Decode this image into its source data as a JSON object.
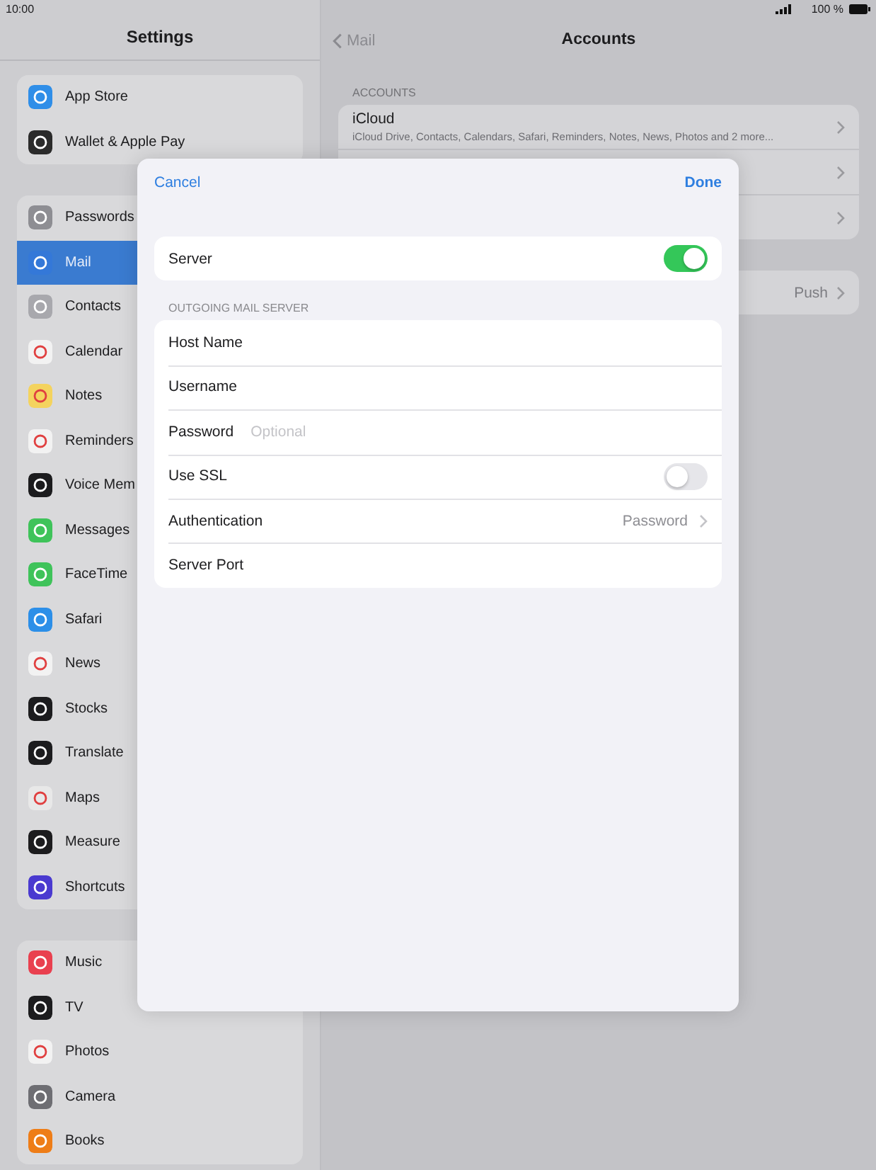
{
  "status_bar": {
    "time": "10:00",
    "battery": "100 %"
  },
  "sidebar": {
    "title": "Settings",
    "groups": [
      {
        "items": [
          {
            "label": "App Store",
            "selected": false
          },
          {
            "label": "Wallet & Apple Pay",
            "selected": false
          }
        ]
      },
      {
        "items": [
          {
            "label": "Passwords",
            "selected": false
          },
          {
            "label": "Mail",
            "selected": true
          },
          {
            "label": "Contacts",
            "selected": false
          },
          {
            "label": "Calendar",
            "selected": false
          },
          {
            "label": "Notes",
            "selected": false
          },
          {
            "label": "Reminders",
            "selected": false
          },
          {
            "label": "Voice Mem",
            "selected": false
          },
          {
            "label": "Messages",
            "selected": false
          },
          {
            "label": "FaceTime",
            "selected": false
          },
          {
            "label": "Safari",
            "selected": false
          },
          {
            "label": "News",
            "selected": false
          },
          {
            "label": "Stocks",
            "selected": false
          },
          {
            "label": "Translate",
            "selected": false
          },
          {
            "label": "Maps",
            "selected": false
          },
          {
            "label": "Measure",
            "selected": false
          },
          {
            "label": "Shortcuts",
            "selected": false
          }
        ]
      },
      {
        "items": [
          {
            "label": "Music",
            "selected": false
          },
          {
            "label": "TV",
            "selected": false
          },
          {
            "label": "Photos",
            "selected": false
          },
          {
            "label": "Camera",
            "selected": false
          },
          {
            "label": "Books",
            "selected": false
          }
        ]
      }
    ]
  },
  "detail": {
    "back": "Mail",
    "title": "Accounts",
    "section": "ACCOUNTS",
    "accounts": [
      {
        "kind": "account",
        "name": "iCloud",
        "subtitle": "iCloud Drive, Contacts, Calendars, Safari, Reminders, Notes, News, Photos and 2 more..."
      },
      {
        "kind": "covered"
      },
      {
        "kind": "covered"
      }
    ],
    "fetch_value": "Push"
  },
  "sheet": {
    "cancel": "Cancel",
    "done": "Done",
    "server": {
      "label": "Server",
      "on": true
    },
    "section": "OUTGOING MAIL SERVER",
    "rows": [
      {
        "kind": "field",
        "label": "Host Name"
      },
      {
        "kind": "field",
        "label": "Username"
      },
      {
        "kind": "field",
        "label": "Password",
        "placeholder": "Optional"
      },
      {
        "kind": "toggle",
        "label": "Use SSL",
        "on": false
      },
      {
        "kind": "link",
        "label": "Authentication",
        "value": "Password"
      },
      {
        "kind": "field",
        "label": "Server Port"
      }
    ]
  }
}
